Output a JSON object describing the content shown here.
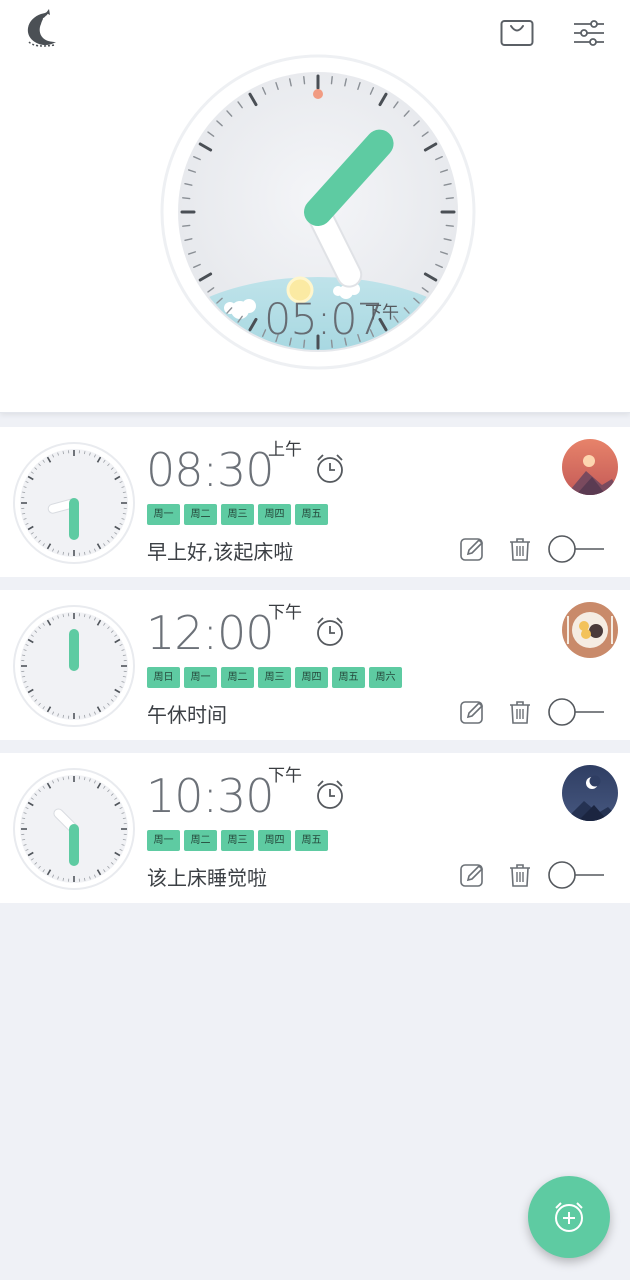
{
  "header": {
    "logo_icon": "cat-icon",
    "shop_icon": "shopping-bag-icon",
    "settings_icon": "sliders-icon",
    "clock": {
      "hour": 5,
      "minute": 7,
      "time_text": "05:07",
      "ampm": "下午",
      "scene": "daytime-sun-clouds"
    }
  },
  "colors": {
    "accent": "#5ecba2",
    "background": "#eff1f6",
    "card": "#ffffff",
    "text": "#3c4045",
    "sky": "#9fd4df",
    "sun": "#fbeaa3",
    "noon_dot": "#f19b82"
  },
  "alarms": [
    {
      "hour": 8,
      "minute": 30,
      "time": "08:30",
      "ampm": "上午",
      "days": [
        "周一",
        "周二",
        "周三",
        "周四",
        "周五"
      ],
      "label": "早上好,该起床啦",
      "avatar": "sunrise-avatar",
      "enabled": false
    },
    {
      "hour": 12,
      "minute": 0,
      "time": "12:00",
      "ampm": "下午",
      "days": [
        "周日",
        "周一",
        "周二",
        "周三",
        "周四",
        "周五",
        "周六"
      ],
      "label": "午休时间",
      "avatar": "meal-avatar",
      "enabled": false
    },
    {
      "hour": 10,
      "minute": 30,
      "time": "10:30",
      "ampm": "下午",
      "days": [
        "周一",
        "周二",
        "周三",
        "周四",
        "周五"
      ],
      "label": "该上床睡觉啦",
      "avatar": "night-moon-avatar",
      "enabled": false
    }
  ],
  "icons": {
    "alarm": "alarm-clock-icon",
    "edit": "edit-icon",
    "delete": "trash-icon",
    "toggle": "toggle-switch",
    "fab": "add-alarm-icon"
  }
}
